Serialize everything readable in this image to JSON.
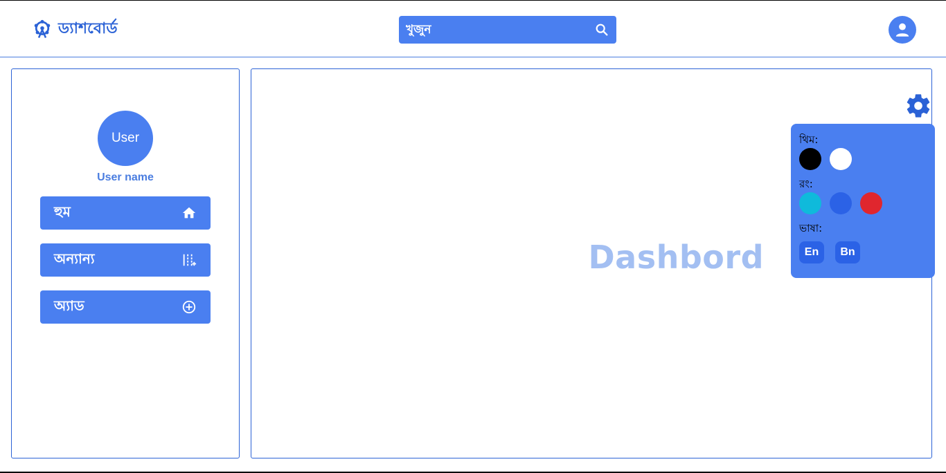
{
  "header": {
    "logo_text": "ড্যাশবোর্ড",
    "logo_icon": "ferris-wheel-icon",
    "search": {
      "placeholder": "খুজুন",
      "icon": "search-icon"
    },
    "account_icon": "account-circle-icon"
  },
  "sidebar": {
    "avatar_text": "User",
    "user_name": "User name",
    "items": [
      {
        "label": "হুম",
        "icon": "home-icon"
      },
      {
        "label": "অন্যান্য",
        "icon": "sliders-icon"
      },
      {
        "label": "অ্যাড",
        "icon": "add-circle-icon"
      }
    ]
  },
  "main": {
    "title": "Dashbord",
    "settings_icon": "gear-icon"
  },
  "settings": {
    "theme_label": "থিম:",
    "theme_options": [
      "#000000",
      "#ffffff"
    ],
    "color_label": "রং:",
    "color_options": [
      "#0fbadb",
      "#2b62e6",
      "#e0262e"
    ],
    "language_label": "ভাষা:",
    "languages": [
      "En",
      "Bn"
    ]
  },
  "colors": {
    "primary": "#4a7ff0",
    "accent": "#2b62d6",
    "title_muted": "#a3bff2"
  }
}
